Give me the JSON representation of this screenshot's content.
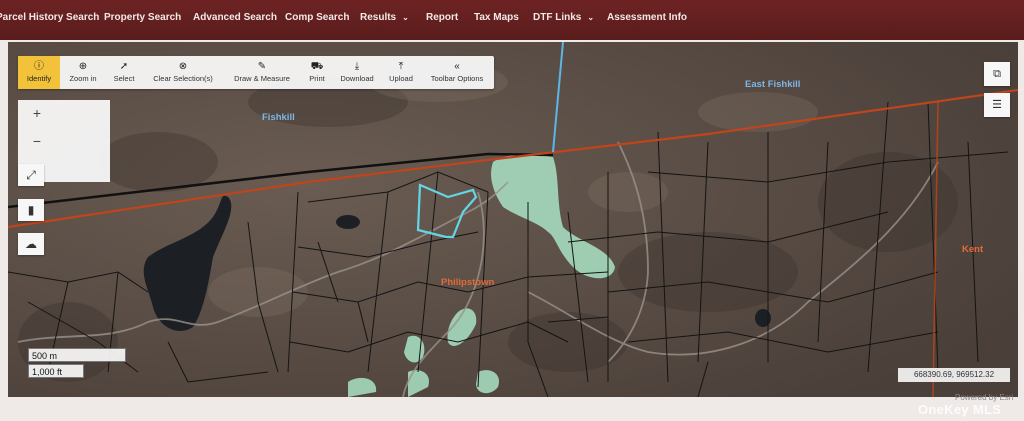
{
  "nav": {
    "items": [
      {
        "label": "Parcel History Search"
      },
      {
        "label": "Property Search"
      },
      {
        "label": "Advanced Search"
      },
      {
        "label": "Comp Search"
      },
      {
        "label": "Results"
      },
      {
        "label": "Report"
      },
      {
        "label": "Tax Maps"
      },
      {
        "label": "DTF Links"
      },
      {
        "label": "Assessment Info"
      }
    ],
    "results_caret": "⌄",
    "dtf_caret": "⌄"
  },
  "toolbar": {
    "tools": [
      {
        "label": "Identify",
        "icon": "info-icon",
        "glyph": "ⓘ",
        "active": true
      },
      {
        "label": "Zoom in",
        "icon": "magnifier-plus-icon",
        "glyph": "⊕"
      },
      {
        "label": "Select",
        "icon": "cursor-arrow-icon",
        "glyph": "➚"
      },
      {
        "label": "Clear Selection(s)",
        "icon": "clear-x-circle-icon",
        "glyph": "⊗"
      },
      {
        "label": "Draw & Measure",
        "icon": "pencil-icon",
        "glyph": "✎"
      },
      {
        "label": "Print",
        "icon": "car-print-icon",
        "glyph": "⛟"
      },
      {
        "label": "Download",
        "icon": "download-arrow-icon",
        "glyph": "⤓"
      },
      {
        "label": "Upload",
        "icon": "upload-arrow-icon",
        "glyph": "⤒"
      },
      {
        "label": "Toolbar Options",
        "icon": "double-chevron-left-icon",
        "glyph": "«"
      }
    ]
  },
  "zoom": {
    "plus": "+",
    "minus": "−"
  },
  "side_buttons": {
    "full_extent": "⤢",
    "bookmark": "▮",
    "cloud_upload": "☁"
  },
  "right_buttons": {
    "basemap": "⧉",
    "layers": "☰"
  },
  "map_labels": {
    "fishkill": "Fishkill",
    "east_fishkill": "East Fishkill",
    "philipstown": "Philipstown",
    "kent": "Kent"
  },
  "scale": {
    "metric": "500 m",
    "imperial": "1,000 ft"
  },
  "coords": "668390.69, 969512.32",
  "powered_by": "Powered by Esri",
  "watermark": "OneKey MLS",
  "colors": {
    "nav_bg": "#6e2323",
    "identify_active": "#f2c23a",
    "selected_parcel": "#63d6e6",
    "wetland_fill": "#a9e3c6",
    "boundary_red": "#c0441c",
    "boundary_black": "#111111",
    "county_line_blue": "#5db5e6"
  }
}
